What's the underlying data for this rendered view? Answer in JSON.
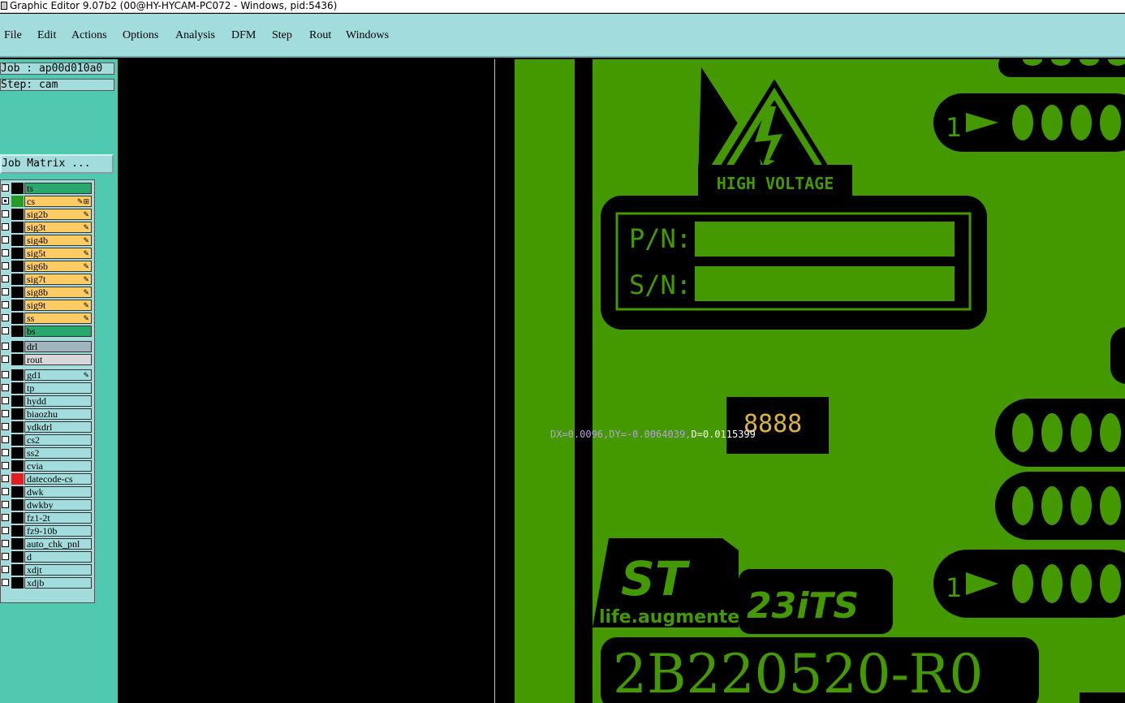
{
  "window": {
    "title": "Graphic Editor 9.07b2 (00@HY-HYCAM-PC072 - Windows, pid:5436)"
  },
  "menu": [
    "File",
    "Edit",
    "Actions",
    "Options",
    "Analysis",
    "DFM",
    "Step",
    "Rout",
    "Windows"
  ],
  "job": {
    "job_label": "Job : ap00d010a0",
    "step_label": "Step: cam",
    "matrix_button": "Job Matrix ..."
  },
  "layers": [
    {
      "name": "ts",
      "bg": "#2aa870",
      "color": "#000000",
      "mark": ""
    },
    {
      "name": "cs",
      "bg": "#ffcc66",
      "color": "#2a9a2a",
      "mark": "✎⊞",
      "selected": true
    },
    {
      "name": "sig2b",
      "bg": "#ffcc66",
      "color": "#000000",
      "mark": "✎"
    },
    {
      "name": "sig3t",
      "bg": "#ffcc66",
      "color": "#000000",
      "mark": "✎"
    },
    {
      "name": "sig4b",
      "bg": "#ffcc66",
      "color": "#000000",
      "mark": "✎"
    },
    {
      "name": "sig5t",
      "bg": "#ffcc66",
      "color": "#000000",
      "mark": "✎"
    },
    {
      "name": "sig6b",
      "bg": "#ffcc66",
      "color": "#000000",
      "mark": "✎"
    },
    {
      "name": "sig7t",
      "bg": "#ffcc66",
      "color": "#000000",
      "mark": "✎"
    },
    {
      "name": "sig8b",
      "bg": "#ffcc66",
      "color": "#000000",
      "mark": "✎"
    },
    {
      "name": "sig9t",
      "bg": "#ffcc66",
      "color": "#000000",
      "mark": "✎"
    },
    {
      "name": "ss",
      "bg": "#ffcc66",
      "color": "#000000",
      "mark": "✎"
    },
    {
      "name": "bs",
      "bg": "#2aa870",
      "color": "#000000",
      "mark": ""
    },
    {
      "name": "drl",
      "bg": "#9fb4bc",
      "color": "#000000",
      "mark": ""
    },
    {
      "name": "rout",
      "bg": "#d8d8d8",
      "color": "#000000",
      "mark": ""
    },
    {
      "name": "gd1",
      "bg": "#a3dcdc",
      "color": "#000000",
      "mark": "✎"
    },
    {
      "name": "tp",
      "bg": "#a3dcdc",
      "color": "#000000",
      "mark": ""
    },
    {
      "name": "hydd",
      "bg": "#a3dcdc",
      "color": "#000000",
      "mark": ""
    },
    {
      "name": "biaozhu",
      "bg": "#a3dcdc",
      "color": "#000000",
      "mark": ""
    },
    {
      "name": "ydkdrl",
      "bg": "#a3dcdc",
      "color": "#000000",
      "mark": ""
    },
    {
      "name": "cs2",
      "bg": "#a3dcdc",
      "color": "#000000",
      "mark": ""
    },
    {
      "name": "ss2",
      "bg": "#a3dcdc",
      "color": "#000000",
      "mark": ""
    },
    {
      "name": "cvia",
      "bg": "#a3dcdc",
      "color": "#000000",
      "mark": ""
    },
    {
      "name": "datecode-cs",
      "bg": "#a3dcdc",
      "color": "#e02020",
      "mark": ""
    },
    {
      "name": "dwk",
      "bg": "#a3dcdc",
      "color": "#000000",
      "mark": ""
    },
    {
      "name": "dwkby",
      "bg": "#a3dcdc",
      "color": "#000000",
      "mark": ""
    },
    {
      "name": "fz1-2t",
      "bg": "#a3dcdc",
      "color": "#000000",
      "mark": ""
    },
    {
      "name": "fz9-10b",
      "bg": "#a3dcdc",
      "color": "#000000",
      "mark": ""
    },
    {
      "name": "auto_chk_pnl",
      "bg": "#a3dcdc",
      "color": "#000000",
      "mark": ""
    },
    {
      "name": "d",
      "bg": "#a3dcdc",
      "color": "#000000",
      "mark": ""
    },
    {
      "name": "xdjt",
      "bg": "#a3dcdc",
      "color": "#000000",
      "mark": ""
    },
    {
      "name": "xdjb",
      "bg": "#a3dcdc",
      "color": "#000000",
      "mark": ""
    }
  ],
  "board": {
    "warning_text": "HIGH VOLTAGE",
    "pn_label": "P/N:",
    "sn_label": "S/N:",
    "logo_st": "ST",
    "logo_tagline": "life.augmented",
    "logo_23its": "23iTS",
    "part_number": "2B220520-R0",
    "pin1_label": "1",
    "datecode_digits": "8888",
    "green": "#449900",
    "black": "#000000"
  },
  "measure": {
    "dx_dy": "DX=0.0096,DY=-0.0064039,",
    "d": "D=0.0115399"
  }
}
